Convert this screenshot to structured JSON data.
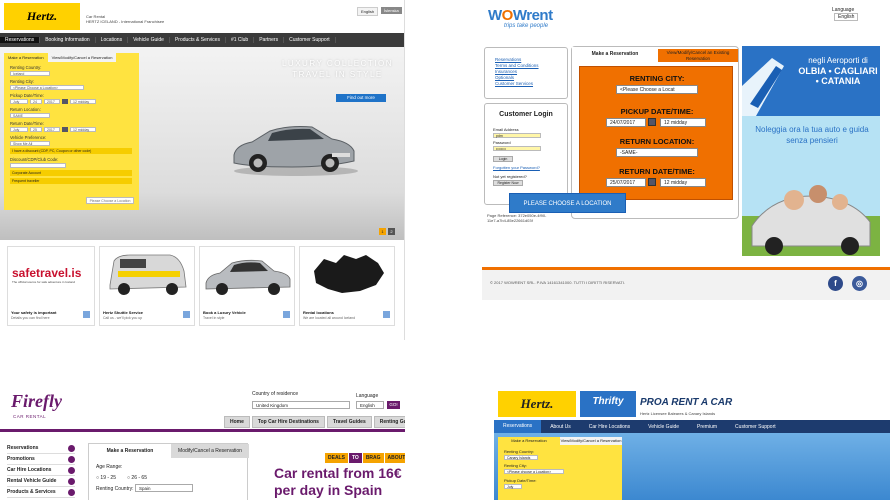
{
  "hertz": {
    "logo": "Hertz.",
    "tagline": [
      "Car Rental",
      "HERTZ ICELAND - International Franchisee"
    ],
    "lang_en": "English",
    "lang_is": "Íslenska",
    "nav": [
      "Reservations",
      "Booking Information",
      "Locations",
      "Vehicle Guide",
      "Products & Services",
      "#1 Club",
      "Partners",
      "Customer Support"
    ],
    "hero_title": [
      "LUXURY COLLECTION",
      "TRAVEL IN STYLE"
    ],
    "find_more": "Find out more",
    "tab_reservation": "Make a Reservation",
    "tab_modify": "View/Modify/Cancel a Reservation",
    "renting_country_label": "Renting Country:",
    "renting_country_value": "Iceland",
    "renting_city_label": "Renting City:",
    "renting_city_value": "<Please Choose a Location>",
    "pickup_label": "Pickup Date/Time:",
    "pickup_date": "July",
    "pickup_day": "24",
    "pickup_year": "2017",
    "pickup_time": "12 midday",
    "return_loc_label": "Return Location:",
    "return_loc_value": "SAME",
    "return_dt_label": "Return Date/Time:",
    "return_date": "July",
    "return_day": "25",
    "return_year": "2017",
    "return_time": "12 midday",
    "vehicle_pref_label": "Vehicle Preference:",
    "vehicle_pref_value": "Show Me All",
    "discount": "I have a discount (CDP, PC, Coupon or other code)",
    "discount_label": "Discount/CDP/Club Code:",
    "corporate": "Corporate Account",
    "frequent": "Frequent traveller",
    "choose_location": "Please Choose a Location",
    "pager": [
      "1",
      "2"
    ],
    "cards": [
      {
        "title": "Your safety is important",
        "sub": "Details you can find here"
      },
      {
        "title": "Hertz Shuttle Service",
        "sub": "Call us - we'll pick you up"
      },
      {
        "title": "Book a Luxury Vehicle",
        "sub": "Travel in style"
      },
      {
        "title": "Rental locations",
        "sub": "We are located all around Iceland"
      }
    ],
    "safetravel_logo": "safetravel.is",
    "safetravel_sub": "The official source for safe adventure in Iceland"
  },
  "wowrent": {
    "logo_wo": "W",
    "logo_o": "O",
    "logo_w": "W",
    "logo_rent": "rent",
    "slogan": "trips take people",
    "language_label": "Language",
    "language_value": "English",
    "links": [
      "Reservations",
      "Terms and Conditions",
      "Insurances",
      "Optionals",
      "Customer Services"
    ],
    "login_title": "Customer Login",
    "email_label": "Email Address",
    "email_value": "pdm",
    "password_label": "Password",
    "password_value": "••••••••",
    "login_btn": "Login",
    "forgot": "Forgotten your Password?",
    "not_registered": "Not yet registered?",
    "register_btn": "Register Now",
    "page_ref": [
      "Page Reference: 372e050e-4f90-",
      "11e7-a7b4-85e22661d03f"
    ],
    "tab_make": "Make a Reservation",
    "tab_view": "View/Modify/Cancel an Existing Reservation",
    "renting_city": "RENTING CITY:",
    "renting_city_value": "<Please Choose a Locat",
    "pickup": "PICKUP DATE/TIME:",
    "pickup_date": "24/07/2017",
    "pickup_time": "12 midday",
    "return_loc": "RETURN LOCATION:",
    "return_loc_value": "-SAME-",
    "return_dt": "RETURN DATE/TIME:",
    "return_date": "25/07/2017",
    "return_time": "12 midday",
    "choose_btn": "PLEASE CHOOSE A LOCATION",
    "ad1_line1": "negli Aeroporti di",
    "ad1_line2": "OLBIA • CAGLIARI • CATANIA",
    "ad2_text": "Noleggia ora la tua auto e guida senza pensieri",
    "copyright": "© 2017 WOWRENT SRL. P.IVA 14161341000. TUTTI I DIRITTI RISERVATI.",
    "fb": "f",
    "ig": "◎"
  },
  "firefly": {
    "logo": "Firefly",
    "sub": "CAR RENTAL",
    "country_label": "Country of residence",
    "country_value": "United Kingdom",
    "language_label": "Language",
    "language_value": "English",
    "go": "GO!",
    "nav": [
      "Home",
      "Top Car Hire Destinations",
      "Travel Guides",
      "Renting Guides"
    ],
    "sidebar": [
      "Reservations",
      "Promotions",
      "Car Hire Locations",
      "Rental Vehicle Guide",
      "Products & Services"
    ],
    "tab_make": "Make a Reservation",
    "tab_modify": "Modify/Cancel a Reservation",
    "age_label": "Age Range:",
    "age1": "19 - 25",
    "age2": "26 - 65",
    "renting_country_label": "Renting Country:",
    "renting_country_value": "Spain",
    "deals": [
      "DEALS",
      "TO",
      "BRAG",
      "ABOUT"
    ],
    "promo": [
      "Car rental from 16€",
      "per day in Spain"
    ]
  },
  "hertz_thrifty": {
    "hertz_logo": "Hertz.",
    "thrifty_logo": "Thrifty",
    "pro_logo": "PROA RENT A CAR",
    "pro_sub": "Hertz Licensee Baleares & Canary Islands",
    "nav": [
      "Reservations",
      "About Us",
      "Car Hire Locations",
      "Vehicle Guide",
      "Premium",
      "Customer Support"
    ],
    "tab_make": "Make a Reservation",
    "tab_modify": "View/Modify/Cancel a Reservation",
    "renting_country_label": "Renting Country:",
    "renting_country_value": "Canary Islands",
    "renting_city_label": "Renting City:",
    "renting_city_value": "<Please choose a Location>",
    "pickup_label": "Pickup Date/Time:",
    "pickup_date": "July"
  },
  "colors": {
    "hertz_yellow": "#ffd100",
    "wow_orange": "#f07000",
    "wow_blue": "#2f7bc9",
    "firefly_purple": "#6a1a6c",
    "thrifty_navy": "#1d3b6e"
  }
}
